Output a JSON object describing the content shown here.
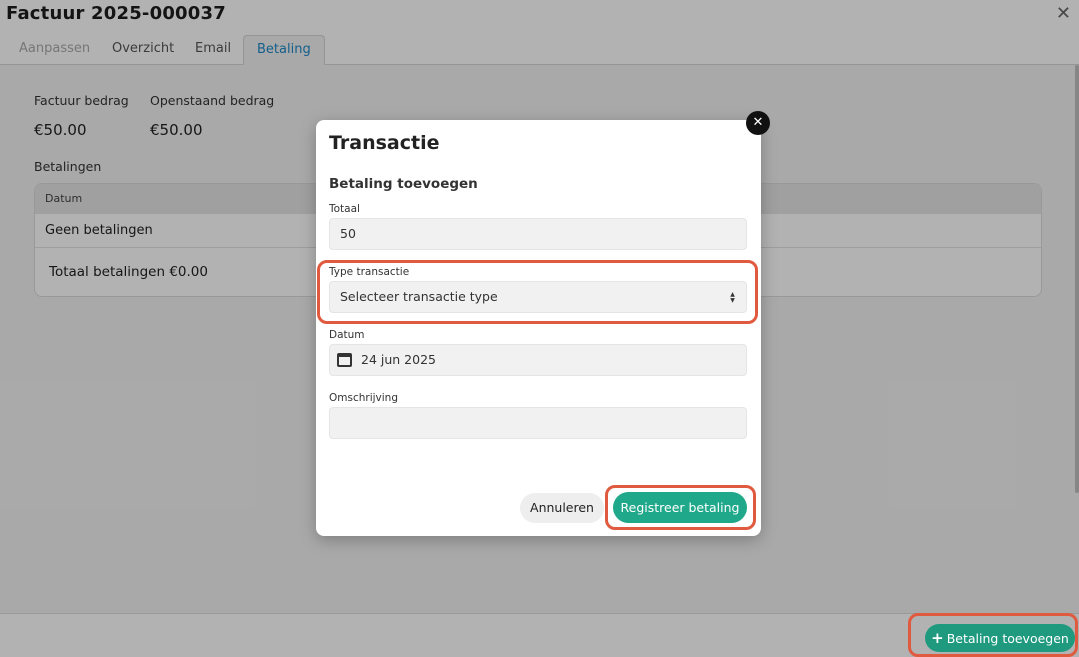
{
  "window": {
    "title": "Factuur 2025-000037",
    "close_glyph": "✕"
  },
  "tabs": [
    {
      "label": "Aanpassen",
      "state": "disabled"
    },
    {
      "label": "Overzicht",
      "state": "normal"
    },
    {
      "label": "Email",
      "state": "normal"
    },
    {
      "label": "Betaling",
      "state": "active"
    }
  ],
  "summary": {
    "invoice_amount_label": "Factuur bedrag",
    "invoice_amount_value": "€50.00",
    "open_amount_label": "Openstaand bedrag",
    "open_amount_value": "€50.00"
  },
  "payments": {
    "section_label": "Betalingen",
    "column_header": "Datum",
    "empty_text": "Geen betalingen",
    "total_text": "Totaal betalingen €0.00"
  },
  "footer": {
    "add_payment_icon": "plus-icon",
    "add_payment_label": "Betaling toevoegen"
  },
  "modal": {
    "title": "Transactie",
    "subtitle": "Betaling toevoegen",
    "close_icon": "close-icon",
    "fields": {
      "total_label": "Totaal",
      "total_value": "50",
      "type_label": "Type transactie",
      "type_value": "Selecteer transactie type",
      "date_label": "Datum",
      "date_value": "24 jun 2025",
      "description_label": "Omschrijving",
      "description_value": ""
    },
    "cancel_label": "Annuleren",
    "register_label": "Registreer betaling"
  },
  "colors": {
    "accent_green": "#20a88a",
    "tab_active_text": "#1e88c7",
    "highlight": "#e05a3f"
  }
}
